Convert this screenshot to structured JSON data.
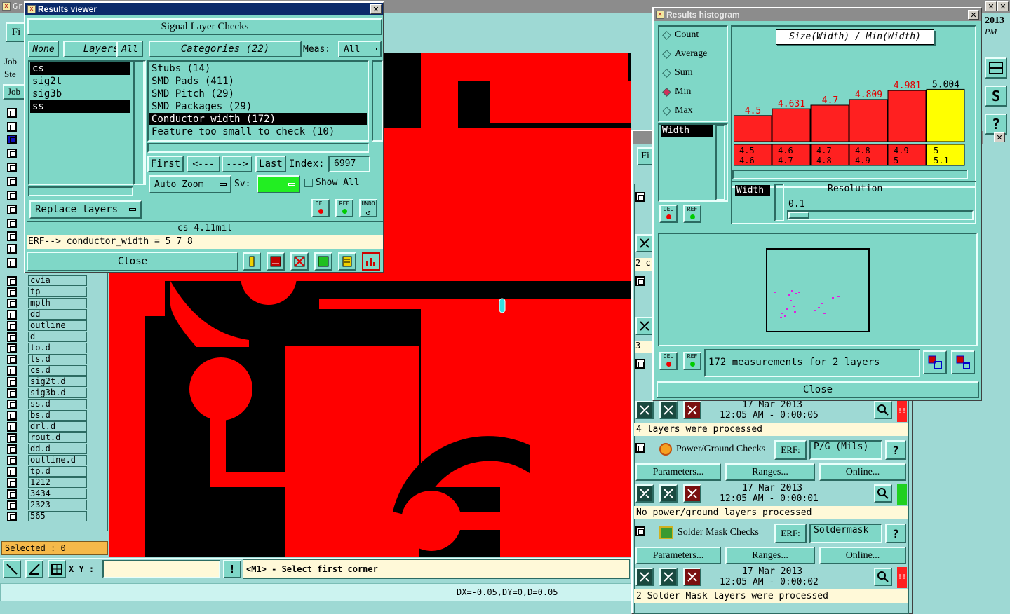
{
  "colors": {
    "teal": "#7fd7c7",
    "canvas_red": "#ff0000",
    "canvas_black": "#000000",
    "yellow": "#ffff00"
  },
  "main": {
    "title_fragment": "Gr",
    "file_menu": "Fi",
    "job_label": "Job",
    "step_label": "Ste",
    "job_btn": "Job",
    "clock_year": "2013",
    "clock_ampm": "PM",
    "layers": [
      "cvia",
      "tp",
      "mpth",
      "dd",
      "outline",
      "d",
      "to.d",
      "ts.d",
      "cs.d",
      "sig2t.d",
      "sig3b.d",
      "ss.d",
      "bs.d",
      "drl.d",
      "rout.d",
      "dd.d",
      "outline.d",
      "tp.d",
      "1212",
      "3434",
      "2323",
      "565"
    ],
    "selected_label": "Selected : 0",
    "xy_label": "X Y :",
    "xy_value": "",
    "prompt": "<M1> - Select first corner",
    "status": "DX=-0.05,DY=0,D=0.05"
  },
  "results_viewer": {
    "title": "Results viewer",
    "header": "Signal Layer Checks",
    "none_btn": "None",
    "layers_btn": "Layers",
    "all_btn": "All",
    "layers": [
      "cs",
      "sig2t",
      "sig3b",
      "ss"
    ],
    "categories_btn": "Categories (22)",
    "meas_label": "Meas:",
    "meas_value": "All",
    "categories": [
      "Stubs (14)",
      "SMD Pads (411)",
      "SMD Pitch (29)",
      "SMD Packages (29)",
      "Conductor width (172)",
      "Feature too small to check (10)"
    ],
    "first_btn": "First",
    "prev_btn": "<---",
    "next_btn": "--->",
    "last_btn": "Last",
    "index_label": "Index:",
    "index_value": "6997",
    "zoom_value": "Auto Zoom",
    "sv_label": "Sv:",
    "show_all_label": "Show All",
    "replace_btn": "Replace layers",
    "del_label": "DEL",
    "ref_label": "REF",
    "undo_label": "UNDO",
    "layer_info": "cs 4.11mil",
    "erf_line": "ERF--> conductor_width = 5 7 8",
    "close_btn": "Close"
  },
  "histogram": {
    "title": "Results histogram",
    "modes": [
      "Count",
      "Average",
      "Sum",
      "Min",
      "Max"
    ],
    "selected_mode": "Min",
    "param": "Width",
    "chart_title": "Size(Width) / Min(Width)",
    "del_label": "DEL",
    "ref_label": "REF",
    "res_param": "Width",
    "resolution_label": "Resolution",
    "resolution_value": "0.1",
    "summary": "172 measurements for 2 layers",
    "close_btn": "Close"
  },
  "chart_data": {
    "type": "bar",
    "title": "Size(Width) / Min(Width)",
    "categories": [
      "4.5-4.6",
      "4.6-4.7",
      "4.7-4.8",
      "4.8-4.9",
      "4.9-5",
      "5-5.1"
    ],
    "category_label_lines": [
      [
        "4.5-",
        "4.6"
      ],
      [
        "4.6-",
        "4.7"
      ],
      [
        "4.7-",
        "4.8"
      ],
      [
        "4.8-",
        "4.9"
      ],
      [
        "4.9-",
        "5"
      ],
      [
        "5-",
        "5.1"
      ]
    ],
    "values": [
      4.5,
      4.631,
      4.7,
      4.809,
      4.981,
      5.004
    ],
    "value_labels": [
      "4.5",
      "4.631",
      "4.7",
      "4.809",
      "4.981",
      "5.004"
    ],
    "bar_colors": [
      "#ff2020",
      "#ff2020",
      "#ff2020",
      "#ff2020",
      "#ff2020",
      "#ffff00"
    ],
    "grid": false
  },
  "checks": {
    "frag_two": "2 c",
    "frag_three": "3",
    "row1_date": "17 Mar 2013",
    "row1_time": "12:05 AM - 0:00:05",
    "row1_status": "4 layers were processed",
    "pg_name": "Power/Ground Checks",
    "pg_erf_label": "ERF:",
    "pg_erf_value": "P/G (Mils)",
    "pg_params": "Parameters...",
    "pg_ranges": "Ranges...",
    "pg_online": "Online...",
    "pg_date": "17 Mar 2013",
    "pg_time": "12:05 AM - 0:00:01",
    "pg_status": "No power/ground layers processed",
    "sm_name": "Solder Mask Checks",
    "sm_erf_label": "ERF:",
    "sm_erf_value": "Soldermask",
    "sm_params": "Parameters...",
    "sm_ranges": "Ranges...",
    "sm_online": "Online...",
    "sm_date": "17 Mar 2013",
    "sm_time": "12:05 AM - 0:00:02",
    "sm_status": "2 Solder Mask layers were processed",
    "help": "?",
    "alert": "!!"
  }
}
